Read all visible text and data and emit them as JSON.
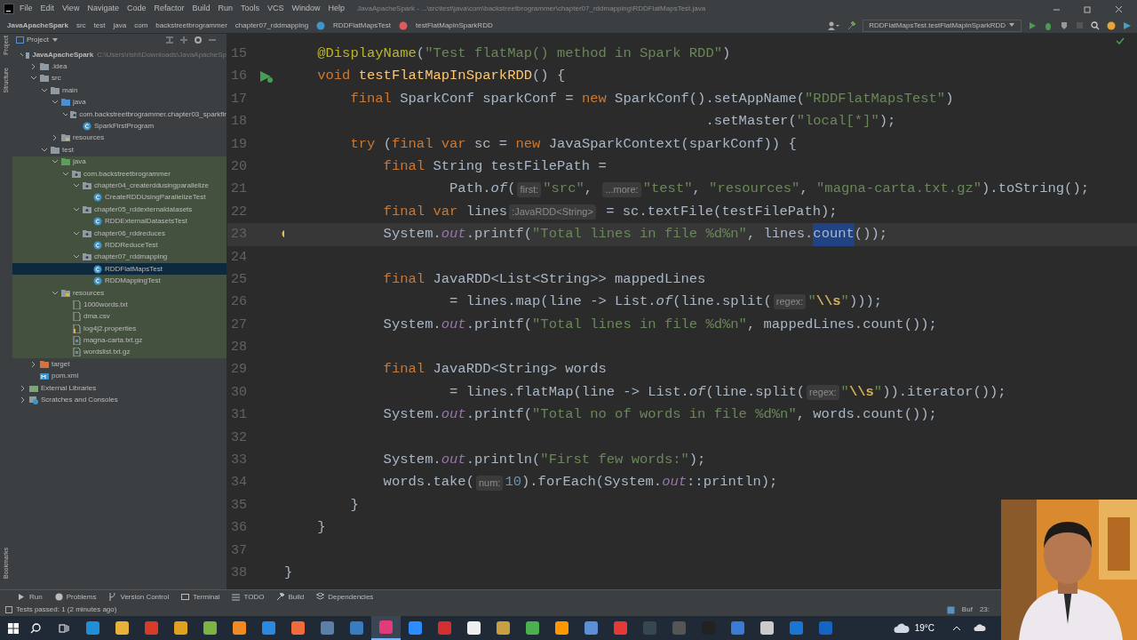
{
  "window": {
    "title": "JavaApacheSpark - ...\\src\\test\\java\\com\\backstreetbrogrammer\\chapter07_rddmapping\\RDDFlatMapsTest.java"
  },
  "menu": [
    "File",
    "Edit",
    "View",
    "Navigate",
    "Code",
    "Refactor",
    "Build",
    "Run",
    "Tools",
    "VCS",
    "Window",
    "Help"
  ],
  "breadcrumbs": [
    {
      "kind": "project",
      "text": "JavaApacheSpark"
    },
    {
      "kind": "folder",
      "text": "src"
    },
    {
      "kind": "folder",
      "text": "test"
    },
    {
      "kind": "folder",
      "text": "java"
    },
    {
      "kind": "folder",
      "text": "com"
    },
    {
      "kind": "folder",
      "text": "backstreetbrogrammer"
    },
    {
      "kind": "folder",
      "text": "chapter07_rddmapping"
    },
    {
      "kind": "class",
      "text": "RDDFlatMapsTest"
    },
    {
      "kind": "method",
      "text": "testFlatMapInSparkRDD"
    }
  ],
  "run_config": "RDDFlatMapsTest.testFlatMapInSparkRDD",
  "side_stripe": {
    "top": [
      "Project",
      "Structure"
    ],
    "bottom": [
      "Bookmarks"
    ]
  },
  "project_panel": {
    "title": "Project",
    "tree": [
      {
        "label": "JavaApacheSpark",
        "path": "C:\\Users\\rishi\\Downloads\\JavaApacheSp",
        "kind": "module",
        "expanded": true,
        "selected": false,
        "tinted": false,
        "children": [
          {
            "label": ".idea",
            "kind": "folder",
            "expanded": false,
            "selected": false,
            "tinted": false
          },
          {
            "label": "src",
            "kind": "folder",
            "expanded": true,
            "selected": false,
            "tinted": false,
            "children": [
              {
                "label": "main",
                "kind": "folder",
                "expanded": true,
                "selected": false,
                "tinted": false,
                "children": [
                  {
                    "label": "java",
                    "kind": "source-folder",
                    "expanded": true,
                    "selected": false,
                    "tinted": false,
                    "children": [
                      {
                        "label": "com.backstreetbrogrammer.chapter03_sparkfir",
                        "kind": "package",
                        "expanded": true,
                        "selected": false,
                        "tinted": false,
                        "children": [
                          {
                            "label": "SparkFirstProgram",
                            "kind": "class",
                            "selected": false,
                            "tinted": false
                          }
                        ]
                      }
                    ]
                  },
                  {
                    "label": "resources",
                    "kind": "resources-folder",
                    "expanded": false,
                    "selected": false,
                    "tinted": false
                  }
                ]
              },
              {
                "label": "test",
                "kind": "folder",
                "expanded": true,
                "selected": false,
                "tinted": false,
                "children": [
                  {
                    "label": "java",
                    "kind": "test-folder",
                    "expanded": true,
                    "selected": false,
                    "tinted": true,
                    "children": [
                      {
                        "label": "com.backstreetbrogrammer",
                        "kind": "package",
                        "expanded": true,
                        "selected": false,
                        "tinted": true,
                        "children": [
                          {
                            "label": "chapter04_createrddusingparallelize",
                            "kind": "package",
                            "expanded": true,
                            "selected": false,
                            "tinted": true,
                            "children": [
                              {
                                "label": "CreateRDDUsingParallelizeTest",
                                "kind": "class",
                                "selected": false,
                                "tinted": true
                              }
                            ]
                          },
                          {
                            "label": "chapter05_rddexternaldatasets",
                            "kind": "package",
                            "expanded": true,
                            "selected": false,
                            "tinted": true,
                            "children": [
                              {
                                "label": "RDDExternalDatasetsTest",
                                "kind": "class",
                                "selected": false,
                                "tinted": true
                              }
                            ]
                          },
                          {
                            "label": "chapter06_rddreduces",
                            "kind": "package",
                            "expanded": true,
                            "selected": false,
                            "tinted": true,
                            "children": [
                              {
                                "label": "RDDReduceTest",
                                "kind": "class",
                                "selected": false,
                                "tinted": true
                              }
                            ]
                          },
                          {
                            "label": "chapter07_rddmapping",
                            "kind": "package",
                            "expanded": true,
                            "selected": false,
                            "tinted": true,
                            "children": [
                              {
                                "label": "RDDFlatMapsTest",
                                "kind": "class",
                                "selected": true,
                                "tinted": true
                              },
                              {
                                "label": "RDDMappingTest",
                                "kind": "class",
                                "selected": false,
                                "tinted": true
                              }
                            ]
                          }
                        ]
                      }
                    ]
                  },
                  {
                    "label": "resources",
                    "kind": "resources-folder",
                    "expanded": true,
                    "selected": false,
                    "tinted": true,
                    "children": [
                      {
                        "label": "1000words.txt",
                        "kind": "file",
                        "selected": false,
                        "tinted": true
                      },
                      {
                        "label": "dma.csv",
                        "kind": "file",
                        "selected": false,
                        "tinted": true
                      },
                      {
                        "label": "log4j2.properties",
                        "kind": "properties",
                        "selected": false,
                        "tinted": true
                      },
                      {
                        "label": "magna-carta.txt.gz",
                        "kind": "archive",
                        "selected": false,
                        "tinted": true
                      },
                      {
                        "label": "wordslist.txt.gz",
                        "kind": "archive",
                        "selected": false,
                        "tinted": true
                      }
                    ]
                  }
                ]
              }
            ]
          },
          {
            "label": "target",
            "kind": "excluded-folder",
            "expanded": false,
            "selected": false,
            "tinted": false
          },
          {
            "label": "pom.xml",
            "kind": "maven",
            "selected": false,
            "tinted": false
          }
        ]
      },
      {
        "label": "External Libraries",
        "kind": "libraries",
        "expanded": false,
        "selected": false,
        "tinted": false
      },
      {
        "label": "Scratches and Consoles",
        "kind": "scratches",
        "expanded": false,
        "selected": false,
        "tinted": false
      }
    ]
  },
  "editor": {
    "lines": [
      {
        "number": "15",
        "kind": "code",
        "current": false,
        "tokens": [
          {
            "kind": "annotation",
            "text": "    @DisplayName"
          },
          {
            "kind": "plain",
            "text": "("
          },
          {
            "kind": "string",
            "text": "\"Test flatMap() method in Spark RDD\""
          },
          {
            "kind": "plain",
            "text": ")"
          }
        ]
      },
      {
        "number": "16",
        "kind": "run",
        "current": false,
        "tokens": [
          {
            "kind": "keyword",
            "text": "    void "
          },
          {
            "kind": "method",
            "text": "testFlatMapInSparkRDD"
          },
          {
            "kind": "plain",
            "text": "() {"
          }
        ]
      },
      {
        "number": "17",
        "current": false,
        "tokens": [
          {
            "kind": "keyword",
            "text": "        final "
          },
          {
            "kind": "plain",
            "text": "SparkConf sparkConf = "
          },
          {
            "kind": "keyword",
            "text": "new "
          },
          {
            "kind": "plain",
            "text": "SparkConf().setAppName("
          },
          {
            "kind": "string",
            "text": "\"RDDFlatMapsTest\""
          },
          {
            "kind": "plain",
            "text": ")"
          }
        ]
      },
      {
        "number": "18",
        "current": false,
        "tokens": [
          {
            "kind": "plain",
            "text": "                                                   .setMaster("
          },
          {
            "kind": "string",
            "text": "\"local[*]\""
          },
          {
            "kind": "plain",
            "text": ");"
          }
        ]
      },
      {
        "number": "19",
        "current": false,
        "tokens": [
          {
            "kind": "keyword",
            "text": "        try "
          },
          {
            "kind": "plain",
            "text": "("
          },
          {
            "kind": "keyword",
            "text": "final var "
          },
          {
            "kind": "plain",
            "text": "sc = "
          },
          {
            "kind": "keyword",
            "text": "new "
          },
          {
            "kind": "plain",
            "text": "JavaSparkContext(sparkConf)) {"
          }
        ]
      },
      {
        "number": "20",
        "current": false,
        "tokens": [
          {
            "kind": "keyword",
            "text": "            final "
          },
          {
            "kind": "plain",
            "text": "String testFilePath ="
          }
        ]
      },
      {
        "number": "21",
        "current": false,
        "tokens": [
          {
            "kind": "plain",
            "text": "                    Path."
          },
          {
            "kind": "static",
            "text": "of"
          },
          {
            "kind": "plain",
            "text": "("
          },
          {
            "kind": "hint",
            "text": "first:"
          },
          {
            "kind": "string",
            "text": "\"src\""
          },
          {
            "kind": "plain",
            "text": ", "
          },
          {
            "kind": "hint",
            "text": "...more:"
          },
          {
            "kind": "string",
            "text": "\"test\""
          },
          {
            "kind": "plain",
            "text": ", "
          },
          {
            "kind": "string",
            "text": "\"resources\""
          },
          {
            "kind": "plain",
            "text": ", "
          },
          {
            "kind": "string",
            "text": "\"magna-carta.txt.gz\""
          },
          {
            "kind": "plain",
            "text": ").toString();"
          }
        ]
      },
      {
        "number": "22",
        "current": false,
        "tokens": [
          {
            "kind": "keyword",
            "text": "            final var "
          },
          {
            "kind": "plain",
            "text": "lines"
          },
          {
            "kind": "hint",
            "text": ":JavaRDD<String>"
          },
          {
            "kind": "plain",
            "text": " = sc.textFile(testFilePath);"
          }
        ]
      },
      {
        "number": "23",
        "kind": "bulb",
        "current": true,
        "tokens": [
          {
            "kind": "plain",
            "text": "            System."
          },
          {
            "kind": "field",
            "text": "out"
          },
          {
            "kind": "plain",
            "text": ".printf("
          },
          {
            "kind": "string",
            "text": "\"Total lines in file %d%n\""
          },
          {
            "kind": "plain",
            "text": ", lines."
          },
          {
            "kind": "selected",
            "text": "count"
          },
          {
            "kind": "plain",
            "text": "());"
          }
        ]
      },
      {
        "number": "24",
        "current": false
      },
      {
        "number": "25",
        "current": false,
        "tokens": [
          {
            "kind": "keyword",
            "text": "            final "
          },
          {
            "kind": "plain",
            "text": "JavaRDD<List<String>> mappedLines"
          }
        ]
      },
      {
        "number": "26",
        "current": false,
        "tokens": [
          {
            "kind": "plain",
            "text": "                    = lines.map(line -> List."
          },
          {
            "kind": "static",
            "text": "of"
          },
          {
            "kind": "plain",
            "text": "(line.split("
          },
          {
            "kind": "hint",
            "text": "regex:"
          },
          {
            "kind": "string",
            "text": "\""
          },
          {
            "kind": "escape",
            "text": "\\\\s"
          },
          {
            "kind": "string",
            "text": "\""
          },
          {
            "kind": "plain",
            "text": ")));"
          }
        ]
      },
      {
        "number": "27",
        "current": false,
        "tokens": [
          {
            "kind": "plain",
            "text": "            System."
          },
          {
            "kind": "field",
            "text": "out"
          },
          {
            "kind": "plain",
            "text": ".printf("
          },
          {
            "kind": "string",
            "text": "\"Total lines in file %d%n\""
          },
          {
            "kind": "plain",
            "text": ", mappedLines.count());"
          }
        ]
      },
      {
        "number": "28",
        "current": false
      },
      {
        "number": "29",
        "current": false,
        "tokens": [
          {
            "kind": "keyword",
            "text": "            final "
          },
          {
            "kind": "plain",
            "text": "JavaRDD<String> words"
          }
        ]
      },
      {
        "number": "30",
        "current": false,
        "tokens": [
          {
            "kind": "plain",
            "text": "                    = lines.flatMap(line -> List."
          },
          {
            "kind": "static",
            "text": "of"
          },
          {
            "kind": "plain",
            "text": "(line.split("
          },
          {
            "kind": "hint",
            "text": "regex:"
          },
          {
            "kind": "string",
            "text": "\""
          },
          {
            "kind": "escape",
            "text": "\\\\s"
          },
          {
            "kind": "string",
            "text": "\""
          },
          {
            "kind": "plain",
            "text": ")).iterator());"
          }
        ]
      },
      {
        "number": "31",
        "current": false,
        "tokens": [
          {
            "kind": "plain",
            "text": "            System."
          },
          {
            "kind": "field",
            "text": "out"
          },
          {
            "kind": "plain",
            "text": ".printf("
          },
          {
            "kind": "string",
            "text": "\"Total no of words in file %d%n\""
          },
          {
            "kind": "plain",
            "text": ", words.count());"
          }
        ]
      },
      {
        "number": "32",
        "current": false
      },
      {
        "number": "33",
        "current": false,
        "tokens": [
          {
            "kind": "plain",
            "text": "            System."
          },
          {
            "kind": "field",
            "text": "out"
          },
          {
            "kind": "plain",
            "text": ".println("
          },
          {
            "kind": "string",
            "text": "\"First few words:\""
          },
          {
            "kind": "plain",
            "text": ");"
          }
        ]
      },
      {
        "number": "34",
        "current": false,
        "tokens": [
          {
            "kind": "plain",
            "text": "            words.take("
          },
          {
            "kind": "hint",
            "text": "num:"
          },
          {
            "kind": "number",
            "text": "10"
          },
          {
            "kind": "plain",
            "text": ").forEach(System."
          },
          {
            "kind": "field",
            "text": "out"
          },
          {
            "kind": "plain",
            "text": "::println);"
          }
        ]
      },
      {
        "number": "35",
        "current": false,
        "tokens": [
          {
            "kind": "plain",
            "text": "        }"
          }
        ]
      },
      {
        "number": "36",
        "current": false,
        "tokens": [
          {
            "kind": "plain",
            "text": "    }"
          }
        ]
      },
      {
        "number": "37",
        "current": false
      },
      {
        "number": "38",
        "current": false,
        "tokens": [
          {
            "kind": "plain",
            "text": "}"
          }
        ]
      }
    ]
  },
  "tool_tabs": [
    {
      "kind": "run",
      "text": "Run"
    },
    {
      "kind": "problems",
      "text": "Problems"
    },
    {
      "kind": "vcs",
      "text": "Version Control"
    },
    {
      "kind": "terminal",
      "text": "Terminal"
    },
    {
      "kind": "todo",
      "text": "TODO"
    },
    {
      "kind": "build",
      "text": "Build"
    },
    {
      "kind": "dependencies",
      "text": "Dependencies"
    }
  ],
  "status_bar": {
    "message": "Tests passed: 1 (2 minutes ago)",
    "right": [
      "Buf",
      "23:"
    ]
  },
  "taskbar": {
    "apps": [
      {
        "color": "#1e8fd8",
        "selected": false
      },
      {
        "color": "#e8b23a",
        "selected": false
      },
      {
        "color": "#d83b2a",
        "selected": false
      },
      {
        "color": "#e0a020",
        "selected": false
      },
      {
        "color": "#7cb342",
        "selected": false
      },
      {
        "color": "#f08a24",
        "selected": false
      },
      {
        "color": "#2a8ae0",
        "selected": false
      },
      {
        "color": "#f26b3a",
        "selected": false
      },
      {
        "color": "#5b7fa8",
        "selected": false
      },
      {
        "color": "#3b7bbf",
        "selected": false
      },
      {
        "color": "#e23b7a",
        "selected": true
      },
      {
        "color": "#2d8cff",
        "selected": false
      },
      {
        "color": "#d32f2f",
        "selected": false
      },
      {
        "color": "#eeeeee",
        "selected": false
      },
      {
        "color": "#c9a040",
        "selected": false
      },
      {
        "color": "#4caf50",
        "selected": false
      },
      {
        "color": "#ff9800",
        "selected": false
      },
      {
        "color": "#5c8fd6",
        "selected": false
      },
      {
        "color": "#e53935",
        "selected": false
      },
      {
        "color": "#37474f",
        "selected": false
      },
      {
        "color": "#555555",
        "selected": false
      },
      {
        "color": "#222222",
        "selected": false
      },
      {
        "color": "#3a7bd5",
        "selected": false
      },
      {
        "color": "#cccccc",
        "selected": false
      },
      {
        "color": "#1976d2",
        "selected": false
      },
      {
        "color": "#1565c0",
        "selected": false
      }
    ],
    "weather": "19°C"
  }
}
